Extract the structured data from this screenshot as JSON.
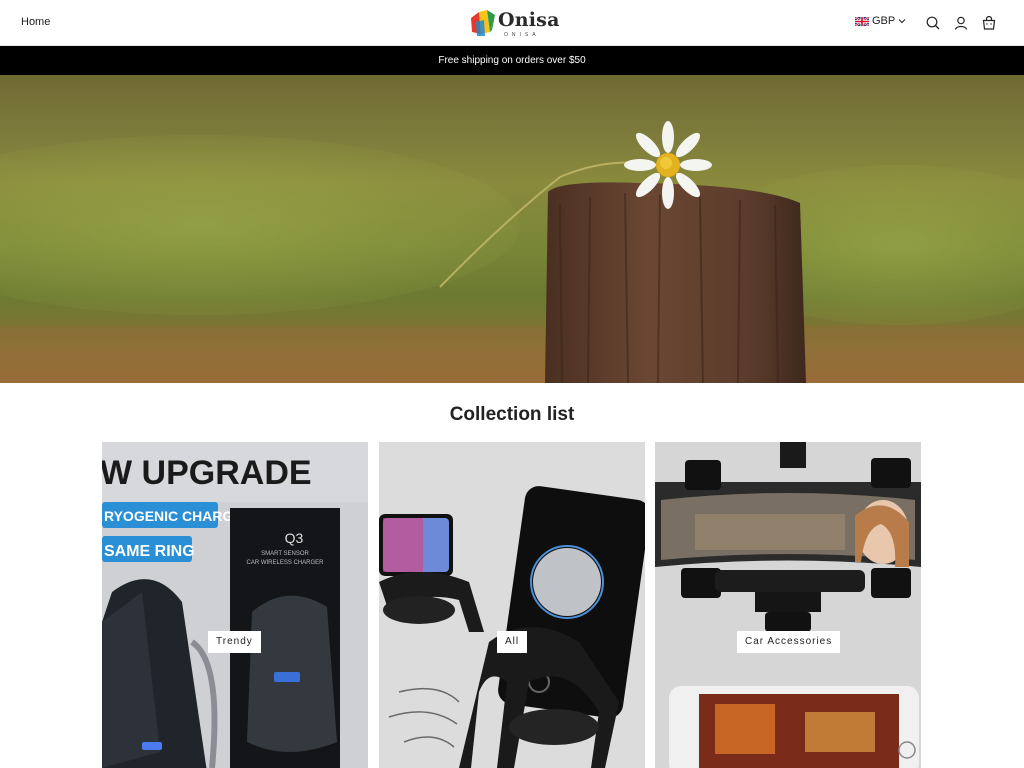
{
  "header": {
    "nav": {
      "home_label": "Home"
    },
    "logo": {
      "name": "Onisa",
      "tagline": "ONISA"
    },
    "currency": {
      "code": "GBP",
      "flag": "uk-flag-icon"
    },
    "icons": [
      "search-icon",
      "account-icon",
      "cart-icon"
    ]
  },
  "announcement": {
    "text": "Free shipping on orders over $50"
  },
  "hero": {
    "image": "daisy-on-wooden-post"
  },
  "collections": {
    "title": "Collection list",
    "items": [
      {
        "label": "Trendy",
        "image": "wireless-car-charger"
      },
      {
        "label": "All",
        "image": "phone-speaker-stand"
      },
      {
        "label": "Car Accessories",
        "image": "rearview-mirror-phone-mount"
      }
    ],
    "promo_texts": {
      "upgrade": "W UPGRADE",
      "charging": "RYOGENIC CHARGING",
      "ring": "SAME RING",
      "model": "Q3",
      "box_line1": "SMART SENSOR",
      "box_line2": "CAR WIRELESS CHARGER"
    }
  },
  "colors": {
    "announcement_bg": "#000000",
    "text": "#121212",
    "promo_blue": "#2b8fd6"
  }
}
